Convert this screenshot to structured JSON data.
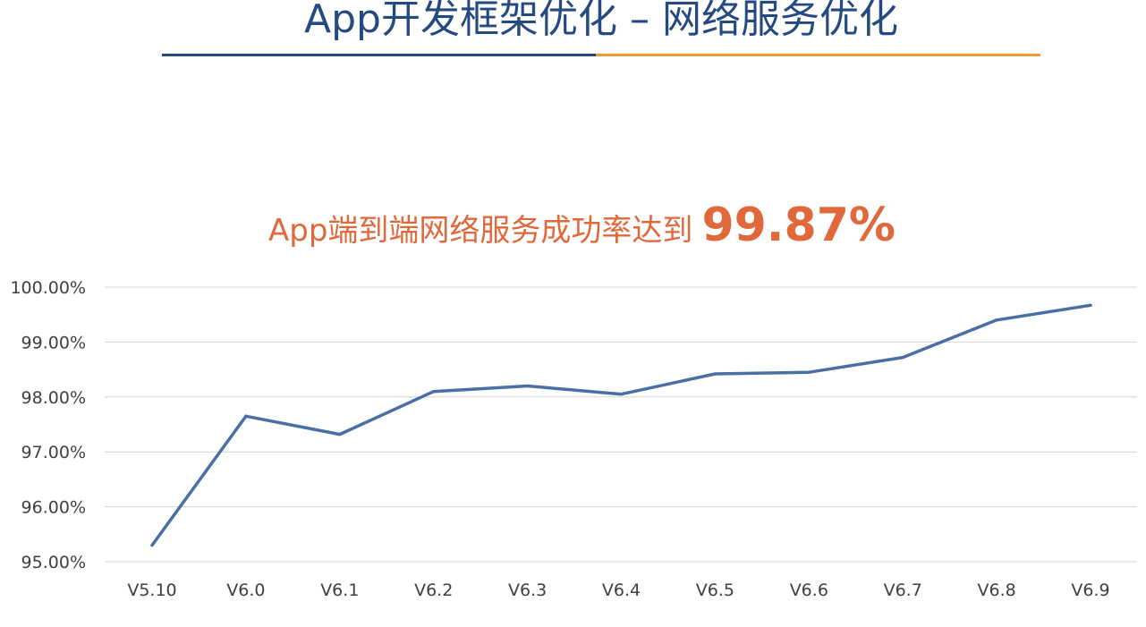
{
  "header": {
    "title": "App开发框架优化 – 网络服务优化",
    "accent_colors": [
      "#254a82",
      "#ec9a32"
    ]
  },
  "headline": {
    "lead": "App端到端网络服务成功率达到",
    "value": "99.87%"
  },
  "chart_data": {
    "type": "line",
    "categories": [
      "V5.10",
      "V6.0",
      "V6.1",
      "V6.2",
      "V6.3",
      "V6.4",
      "V6.5",
      "V6.6",
      "V6.7",
      "V6.8",
      "V6.9"
    ],
    "series": [
      {
        "values": [
          95.3,
          97.65,
          97.32,
          98.1,
          98.2,
          98.05,
          98.42,
          98.45,
          98.72,
          99.4,
          99.67
        ],
        "color": "#4a6fa5"
      }
    ],
    "ylim": [
      95,
      100
    ],
    "yticks": [
      "100.00%",
      "99.00%",
      "98.00%",
      "97.00%",
      "96.00%",
      "95.00%"
    ],
    "grid": true,
    "legend": "none",
    "xlabel": "",
    "ylabel": ""
  }
}
